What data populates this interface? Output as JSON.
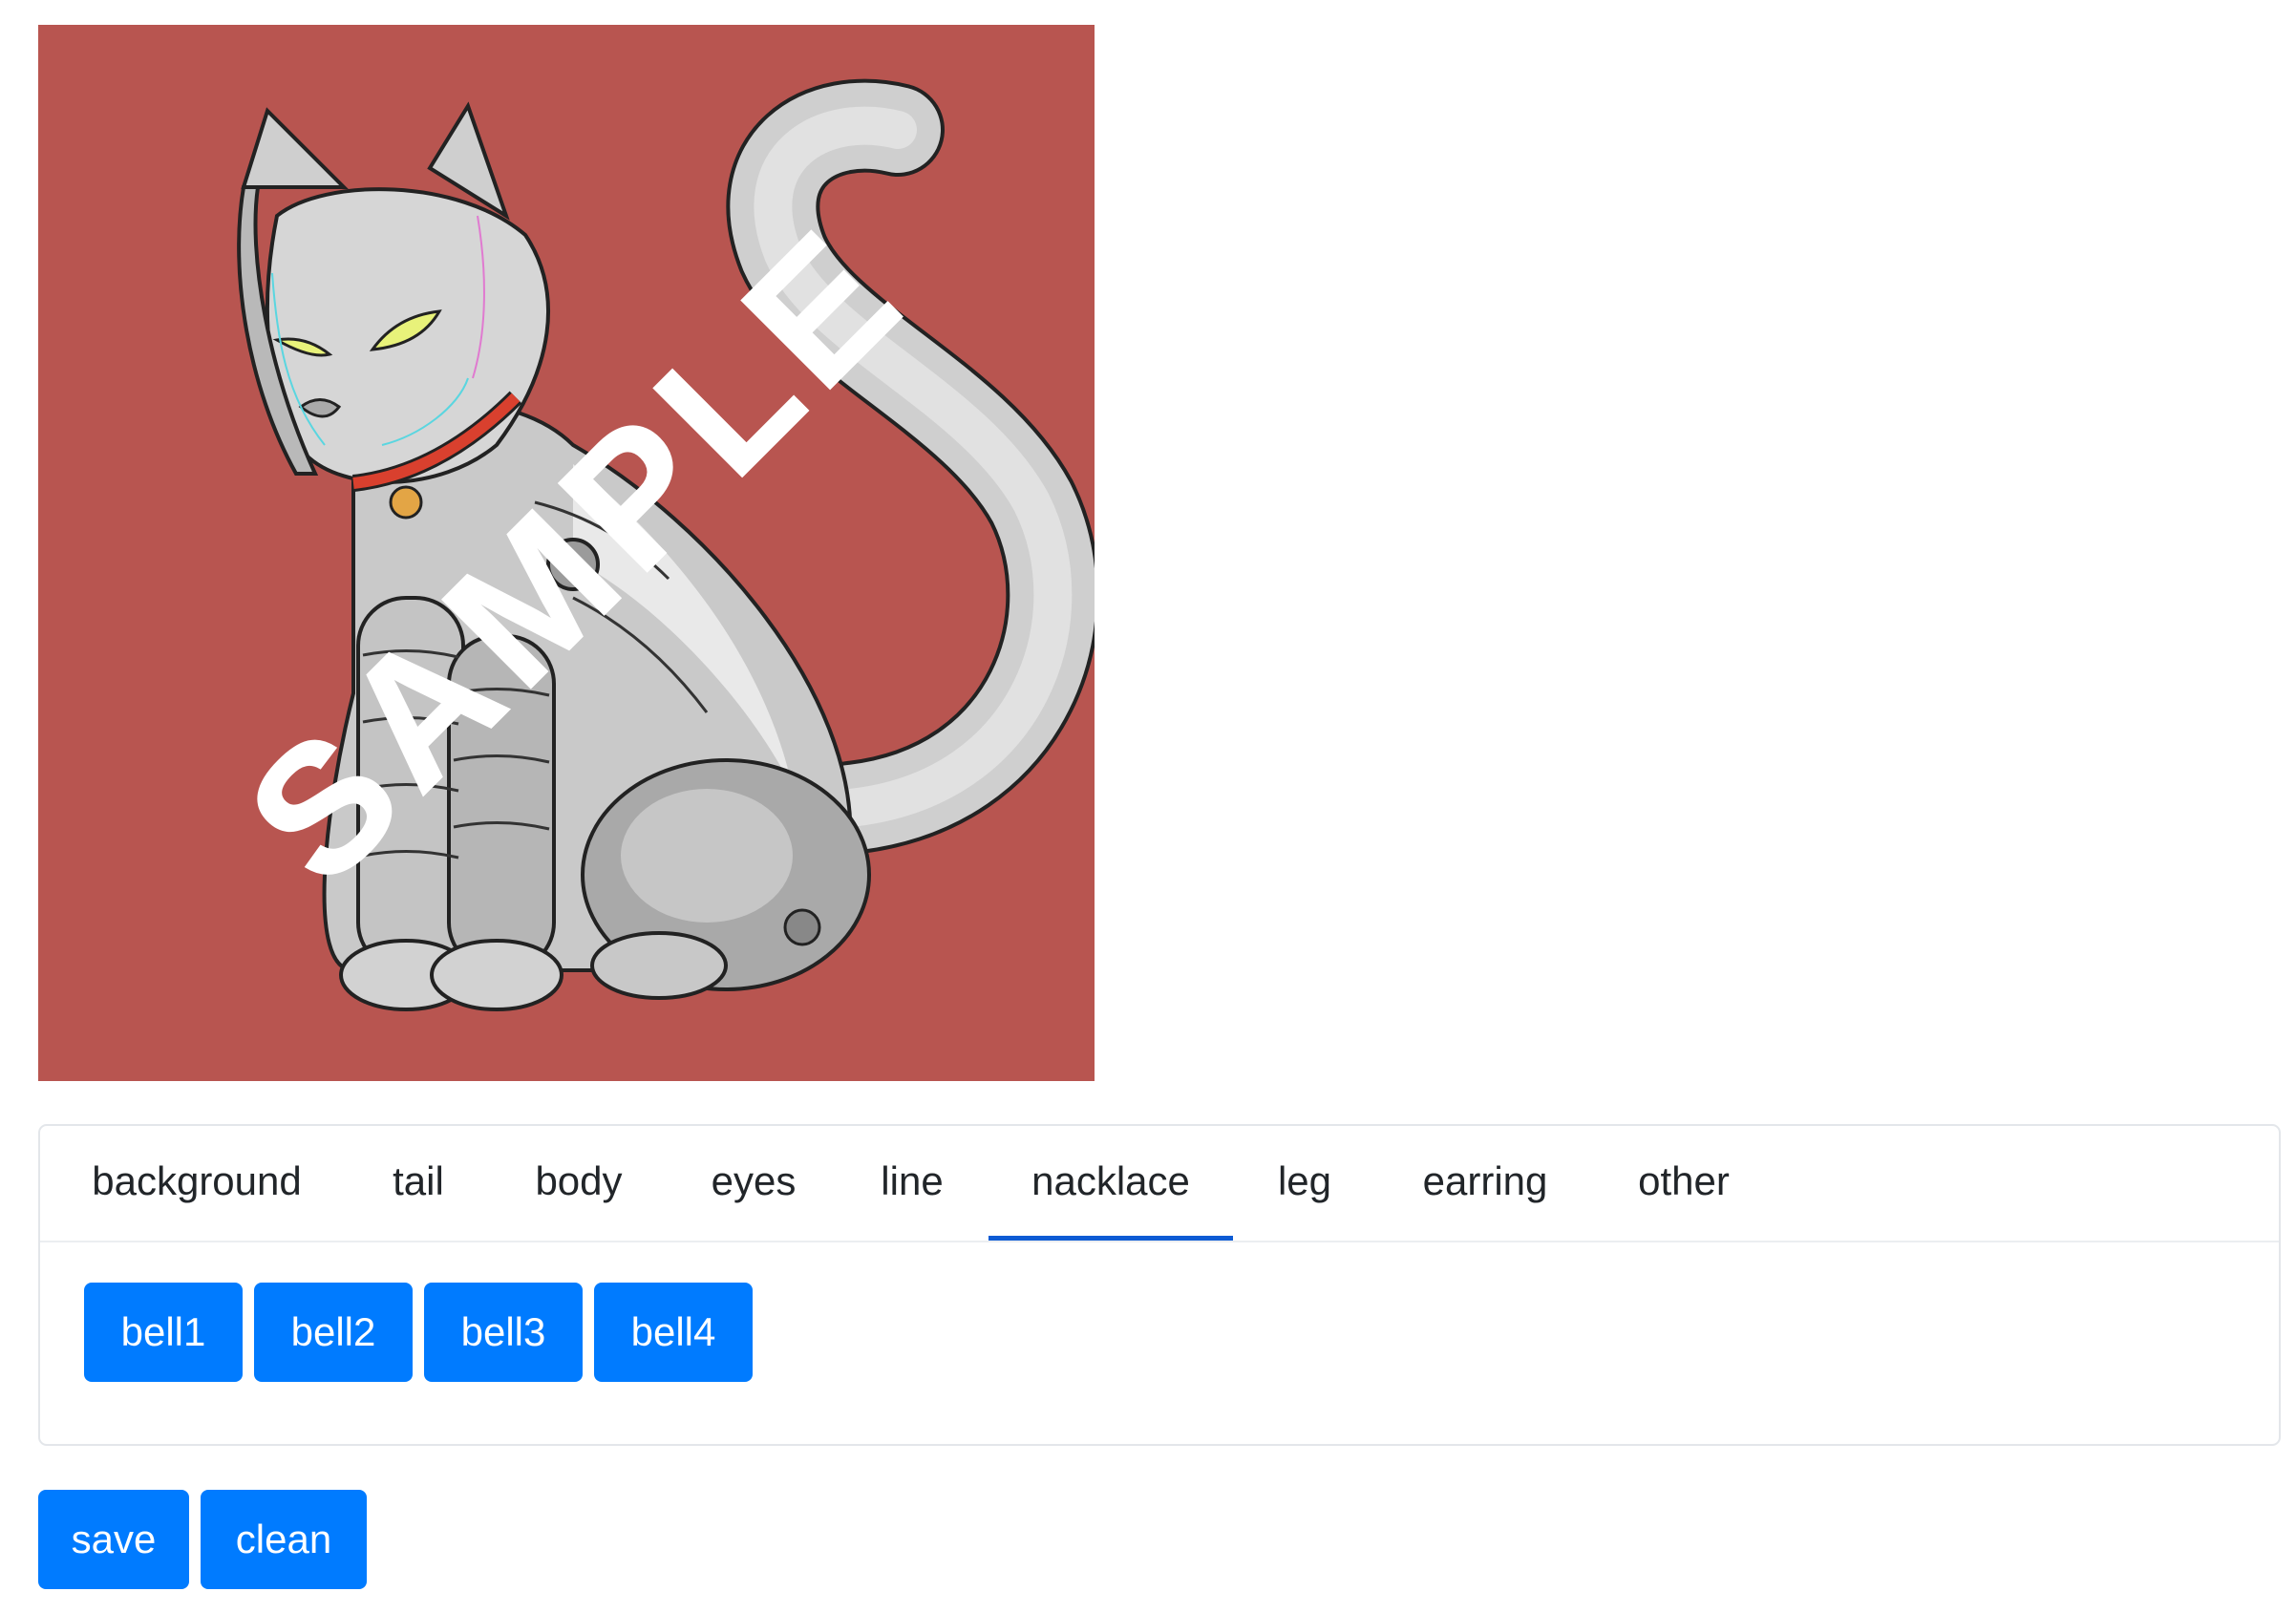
{
  "preview": {
    "background_color": "#b85550",
    "watermark": "SAMPLE"
  },
  "tabs": [
    {
      "label": "background"
    },
    {
      "label": "tail"
    },
    {
      "label": "body"
    },
    {
      "label": "eyes"
    },
    {
      "label": "line"
    },
    {
      "label": "nacklace",
      "active": true
    },
    {
      "label": "leg"
    },
    {
      "label": "earring"
    },
    {
      "label": "other"
    }
  ],
  "options": [
    {
      "label": "bell1"
    },
    {
      "label": "bell2"
    },
    {
      "label": "bell3"
    },
    {
      "label": "bell4"
    }
  ],
  "actions": {
    "save_label": "save",
    "clean_label": "clean"
  },
  "colors": {
    "button": "#007bff",
    "active_tab_underline": "#0d5bd4"
  }
}
